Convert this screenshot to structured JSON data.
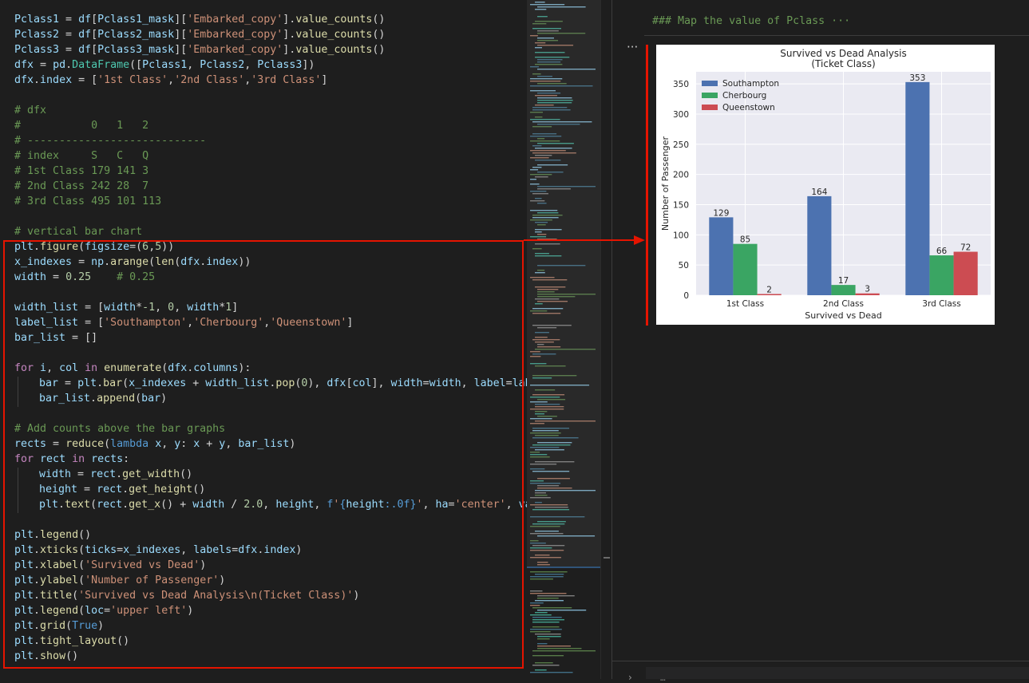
{
  "code_lines": [
    {
      "row": 0,
      "indent": 0,
      "tokens": [
        [
          "var",
          "Pclass1"
        ],
        [
          "p",
          " = "
        ],
        [
          "var",
          "df"
        ],
        [
          "p",
          "["
        ],
        [
          "var",
          "Pclass1_mask"
        ],
        [
          "p",
          "]["
        ],
        [
          "str",
          "'Embarked_copy'"
        ],
        [
          "p",
          "]."
        ],
        [
          "fn",
          "value_counts"
        ],
        [
          "p",
          "()"
        ]
      ]
    },
    {
      "row": 1,
      "indent": 0,
      "tokens": [
        [
          "var",
          "Pclass2"
        ],
        [
          "p",
          " = "
        ],
        [
          "var",
          "df"
        ],
        [
          "p",
          "["
        ],
        [
          "var",
          "Pclass2_mask"
        ],
        [
          "p",
          "]["
        ],
        [
          "str",
          "'Embarked_copy'"
        ],
        [
          "p",
          "]."
        ],
        [
          "fn",
          "value_counts"
        ],
        [
          "p",
          "()"
        ]
      ]
    },
    {
      "row": 2,
      "indent": 0,
      "tokens": [
        [
          "var",
          "Pclass3"
        ],
        [
          "p",
          " = "
        ],
        [
          "var",
          "df"
        ],
        [
          "p",
          "["
        ],
        [
          "var",
          "Pclass3_mask"
        ],
        [
          "p",
          "]["
        ],
        [
          "str",
          "'Embarked_copy'"
        ],
        [
          "p",
          "]."
        ],
        [
          "fn",
          "value_counts"
        ],
        [
          "p",
          "()"
        ]
      ]
    },
    {
      "row": 3,
      "indent": 0,
      "tokens": [
        [
          "var",
          "dfx"
        ],
        [
          "p",
          " = "
        ],
        [
          "var",
          "pd"
        ],
        [
          "p",
          "."
        ],
        [
          "cls",
          "DataFrame"
        ],
        [
          "p",
          "(["
        ],
        [
          "var",
          "Pclass1"
        ],
        [
          "p",
          ", "
        ],
        [
          "var",
          "Pclass2"
        ],
        [
          "p",
          ", "
        ],
        [
          "var",
          "Pclass3"
        ],
        [
          "p",
          "])"
        ]
      ]
    },
    {
      "row": 4,
      "indent": 0,
      "tokens": [
        [
          "var",
          "dfx"
        ],
        [
          "p",
          "."
        ],
        [
          "var",
          "index"
        ],
        [
          "p",
          " = ["
        ],
        [
          "str",
          "'1st Class'"
        ],
        [
          "p",
          ","
        ],
        [
          "str",
          "'2nd Class'"
        ],
        [
          "p",
          ","
        ],
        [
          "str",
          "'3rd Class'"
        ],
        [
          "p",
          "]"
        ]
      ]
    },
    {
      "row": 6,
      "indent": 0,
      "tokens": [
        [
          "cmt",
          "# dfx"
        ]
      ]
    },
    {
      "row": 7,
      "indent": 0,
      "tokens": [
        [
          "cmt",
          "#           0   1   2"
        ]
      ]
    },
    {
      "row": 8,
      "indent": 0,
      "tokens": [
        [
          "cmt",
          "# ----------------------------"
        ]
      ]
    },
    {
      "row": 9,
      "indent": 0,
      "tokens": [
        [
          "cmt",
          "# index     S   C   Q"
        ]
      ]
    },
    {
      "row": 10,
      "indent": 0,
      "tokens": [
        [
          "cmt",
          "# 1st Class 179 141 3"
        ]
      ]
    },
    {
      "row": 11,
      "indent": 0,
      "tokens": [
        [
          "cmt",
          "# 2nd Class 242 28  7"
        ]
      ]
    },
    {
      "row": 12,
      "indent": 0,
      "tokens": [
        [
          "cmt",
          "# 3rd Class 495 101 113"
        ]
      ]
    },
    {
      "row": 14,
      "indent": 0,
      "tokens": [
        [
          "cmt",
          "# vertical bar chart"
        ]
      ]
    },
    {
      "row": 15,
      "indent": 0,
      "tokens": [
        [
          "var",
          "plt"
        ],
        [
          "p",
          "."
        ],
        [
          "fn",
          "figure"
        ],
        [
          "p",
          "("
        ],
        [
          "var",
          "figsize"
        ],
        [
          "p",
          "=("
        ],
        [
          "num",
          "6"
        ],
        [
          "p",
          ","
        ],
        [
          "num",
          "5"
        ],
        [
          "p",
          "))"
        ]
      ]
    },
    {
      "row": 16,
      "indent": 0,
      "tokens": [
        [
          "var",
          "x_indexes"
        ],
        [
          "p",
          " = "
        ],
        [
          "var",
          "np"
        ],
        [
          "p",
          "."
        ],
        [
          "fn",
          "arange"
        ],
        [
          "p",
          "("
        ],
        [
          "fn",
          "len"
        ],
        [
          "p",
          "("
        ],
        [
          "var",
          "dfx"
        ],
        [
          "p",
          "."
        ],
        [
          "var",
          "index"
        ],
        [
          "p",
          "))"
        ]
      ]
    },
    {
      "row": 17,
      "indent": 0,
      "tokens": [
        [
          "var",
          "width"
        ],
        [
          "p",
          " = "
        ],
        [
          "num",
          "0.25"
        ],
        [
          "p",
          "    "
        ],
        [
          "cmt",
          "# 0.25"
        ]
      ]
    },
    {
      "row": 19,
      "indent": 0,
      "tokens": [
        [
          "var",
          "width_list"
        ],
        [
          "p",
          " = ["
        ],
        [
          "var",
          "width"
        ],
        [
          "p",
          "*"
        ],
        [
          "num",
          "-1"
        ],
        [
          "p",
          ", "
        ],
        [
          "num",
          "0"
        ],
        [
          "p",
          ", "
        ],
        [
          "var",
          "width"
        ],
        [
          "p",
          "*"
        ],
        [
          "num",
          "1"
        ],
        [
          "p",
          "]"
        ]
      ]
    },
    {
      "row": 20,
      "indent": 0,
      "tokens": [
        [
          "var",
          "label_list"
        ],
        [
          "p",
          " = ["
        ],
        [
          "str",
          "'Southampton'"
        ],
        [
          "p",
          ","
        ],
        [
          "str",
          "'Cherbourg'"
        ],
        [
          "p",
          ","
        ],
        [
          "str",
          "'Queenstown'"
        ],
        [
          "p",
          "]"
        ]
      ]
    },
    {
      "row": 21,
      "indent": 0,
      "tokens": [
        [
          "var",
          "bar_list"
        ],
        [
          "p",
          " = []"
        ]
      ]
    },
    {
      "row": 23,
      "indent": 0,
      "tokens": [
        [
          "kw",
          "for"
        ],
        [
          "p",
          " "
        ],
        [
          "var",
          "i"
        ],
        [
          "p",
          ", "
        ],
        [
          "var",
          "col"
        ],
        [
          "p",
          " "
        ],
        [
          "kw",
          "in"
        ],
        [
          "p",
          " "
        ],
        [
          "fn",
          "enumerate"
        ],
        [
          "p",
          "("
        ],
        [
          "var",
          "dfx"
        ],
        [
          "p",
          "."
        ],
        [
          "var",
          "columns"
        ],
        [
          "p",
          "):"
        ]
      ]
    },
    {
      "row": 24,
      "indent": 1,
      "tokens": [
        [
          "var",
          "bar"
        ],
        [
          "p",
          " = "
        ],
        [
          "var",
          "plt"
        ],
        [
          "p",
          "."
        ],
        [
          "fn",
          "bar"
        ],
        [
          "p",
          "("
        ],
        [
          "var",
          "x_indexes"
        ],
        [
          "p",
          " + "
        ],
        [
          "var",
          "width_list"
        ],
        [
          "p",
          "."
        ],
        [
          "fn",
          "pop"
        ],
        [
          "p",
          "("
        ],
        [
          "num",
          "0"
        ],
        [
          "p",
          "), "
        ],
        [
          "var",
          "dfx"
        ],
        [
          "p",
          "["
        ],
        [
          "var",
          "col"
        ],
        [
          "p",
          "], "
        ],
        [
          "var",
          "width"
        ],
        [
          "p",
          "="
        ],
        [
          "var",
          "width"
        ],
        [
          "p",
          ", "
        ],
        [
          "var",
          "label"
        ],
        [
          "p",
          "="
        ],
        [
          "var",
          "label"
        ]
      ]
    },
    {
      "row": 25,
      "indent": 1,
      "tokens": [
        [
          "var",
          "bar_list"
        ],
        [
          "p",
          "."
        ],
        [
          "fn",
          "append"
        ],
        [
          "p",
          "("
        ],
        [
          "var",
          "bar"
        ],
        [
          "p",
          ")"
        ]
      ]
    },
    {
      "row": 27,
      "indent": 0,
      "tokens": [
        [
          "cmt",
          "# Add counts above the bar graphs"
        ]
      ]
    },
    {
      "row": 28,
      "indent": 0,
      "tokens": [
        [
          "var",
          "rects"
        ],
        [
          "p",
          " = "
        ],
        [
          "fn",
          "reduce"
        ],
        [
          "p",
          "("
        ],
        [
          "const",
          "lambda"
        ],
        [
          "p",
          " "
        ],
        [
          "var",
          "x"
        ],
        [
          "p",
          ", "
        ],
        [
          "var",
          "y"
        ],
        [
          "p",
          ": "
        ],
        [
          "var",
          "x"
        ],
        [
          "p",
          " + "
        ],
        [
          "var",
          "y"
        ],
        [
          "p",
          ", "
        ],
        [
          "var",
          "bar_list"
        ],
        [
          "p",
          ")"
        ]
      ]
    },
    {
      "row": 29,
      "indent": 0,
      "tokens": [
        [
          "kw",
          "for"
        ],
        [
          "p",
          " "
        ],
        [
          "var",
          "rect"
        ],
        [
          "p",
          " "
        ],
        [
          "kw",
          "in"
        ],
        [
          "p",
          " "
        ],
        [
          "var",
          "rects"
        ],
        [
          "p",
          ":"
        ]
      ]
    },
    {
      "row": 30,
      "indent": 1,
      "tokens": [
        [
          "var",
          "width"
        ],
        [
          "p",
          " = "
        ],
        [
          "var",
          "rect"
        ],
        [
          "p",
          "."
        ],
        [
          "fn",
          "get_width"
        ],
        [
          "p",
          "()"
        ]
      ]
    },
    {
      "row": 31,
      "indent": 1,
      "tokens": [
        [
          "var",
          "height"
        ],
        [
          "p",
          " = "
        ],
        [
          "var",
          "rect"
        ],
        [
          "p",
          "."
        ],
        [
          "fn",
          "get_height"
        ],
        [
          "p",
          "()"
        ]
      ]
    },
    {
      "row": 32,
      "indent": 1,
      "tokens": [
        [
          "var",
          "plt"
        ],
        [
          "p",
          "."
        ],
        [
          "fn",
          "text"
        ],
        [
          "p",
          "("
        ],
        [
          "var",
          "rect"
        ],
        [
          "p",
          "."
        ],
        [
          "fn",
          "get_x"
        ],
        [
          "p",
          "() + "
        ],
        [
          "var",
          "width"
        ],
        [
          "p",
          " / "
        ],
        [
          "num",
          "2.0"
        ],
        [
          "p",
          ", "
        ],
        [
          "var",
          "height"
        ],
        [
          "p",
          ", "
        ],
        [
          "const",
          "f"
        ],
        [
          "str",
          "'"
        ],
        [
          "const",
          "{"
        ],
        [
          "var",
          "height"
        ],
        [
          "const",
          ":.0f}"
        ],
        [
          "str",
          "'"
        ],
        [
          "p",
          ", "
        ],
        [
          "var",
          "ha"
        ],
        [
          "p",
          "="
        ],
        [
          "str",
          "'center'"
        ],
        [
          "p",
          ", "
        ],
        [
          "var",
          "va"
        ],
        [
          "p",
          "="
        ],
        [
          "str",
          "'"
        ]
      ]
    },
    {
      "row": 34,
      "indent": 0,
      "tokens": [
        [
          "var",
          "plt"
        ],
        [
          "p",
          "."
        ],
        [
          "fn",
          "legend"
        ],
        [
          "p",
          "()"
        ]
      ]
    },
    {
      "row": 35,
      "indent": 0,
      "tokens": [
        [
          "var",
          "plt"
        ],
        [
          "p",
          "."
        ],
        [
          "fn",
          "xticks"
        ],
        [
          "p",
          "("
        ],
        [
          "var",
          "ticks"
        ],
        [
          "p",
          "="
        ],
        [
          "var",
          "x_indexes"
        ],
        [
          "p",
          ", "
        ],
        [
          "var",
          "labels"
        ],
        [
          "p",
          "="
        ],
        [
          "var",
          "dfx"
        ],
        [
          "p",
          "."
        ],
        [
          "var",
          "index"
        ],
        [
          "p",
          ")"
        ]
      ]
    },
    {
      "row": 36,
      "indent": 0,
      "tokens": [
        [
          "var",
          "plt"
        ],
        [
          "p",
          "."
        ],
        [
          "fn",
          "xlabel"
        ],
        [
          "p",
          "("
        ],
        [
          "str",
          "'Survived vs Dead'"
        ],
        [
          "p",
          ")"
        ]
      ]
    },
    {
      "row": 37,
      "indent": 0,
      "tokens": [
        [
          "var",
          "plt"
        ],
        [
          "p",
          "."
        ],
        [
          "fn",
          "ylabel"
        ],
        [
          "p",
          "("
        ],
        [
          "str",
          "'Number of Passenger'"
        ],
        [
          "p",
          ")"
        ]
      ]
    },
    {
      "row": 38,
      "indent": 0,
      "tokens": [
        [
          "var",
          "plt"
        ],
        [
          "p",
          "."
        ],
        [
          "fn",
          "title"
        ],
        [
          "p",
          "("
        ],
        [
          "str",
          "'Survived vs Dead Analysis\\n(Ticket Class)'"
        ],
        [
          "p",
          ")"
        ]
      ]
    },
    {
      "row": 39,
      "indent": 0,
      "tokens": [
        [
          "var",
          "plt"
        ],
        [
          "p",
          "."
        ],
        [
          "fn",
          "legend"
        ],
        [
          "p",
          "("
        ],
        [
          "var",
          "loc"
        ],
        [
          "p",
          "="
        ],
        [
          "str",
          "'upper left'"
        ],
        [
          "p",
          ")"
        ]
      ]
    },
    {
      "row": 40,
      "indent": 0,
      "tokens": [
        [
          "var",
          "plt"
        ],
        [
          "p",
          "."
        ],
        [
          "fn",
          "grid"
        ],
        [
          "p",
          "("
        ],
        [
          "const",
          "True"
        ],
        [
          "p",
          ")"
        ]
      ]
    },
    {
      "row": 41,
      "indent": 0,
      "tokens": [
        [
          "var",
          "plt"
        ],
        [
          "p",
          "."
        ],
        [
          "fn",
          "tight_layout"
        ],
        [
          "p",
          "()"
        ]
      ]
    },
    {
      "row": 42,
      "indent": 0,
      "tokens": [
        [
          "var",
          "plt"
        ],
        [
          "p",
          "."
        ],
        [
          "fn",
          "show"
        ],
        [
          "p",
          "()"
        ]
      ]
    }
  ],
  "output": {
    "markdown_heading": "### Map the value of Pclass ···",
    "more_actions": "···",
    "next_cell_text": "…"
  },
  "chart_data": {
    "type": "bar",
    "title": "Survived vs Dead Analysis\n(Ticket Class)",
    "xlabel": "Survived vs Dead",
    "ylabel": "Number of Passenger",
    "categories": [
      "1st Class",
      "2nd Class",
      "3rd Class"
    ],
    "series": [
      {
        "name": "Southampton",
        "values": [
          129,
          164,
          353
        ],
        "color": "#4c72b0"
      },
      {
        "name": "Cherbourg",
        "values": [
          85,
          17,
          66
        ],
        "color": "#3aa563"
      },
      {
        "name": "Queenstown",
        "values": [
          2,
          3,
          72
        ],
        "color": "#cc4c52"
      }
    ],
    "ylim": [
      0,
      370
    ],
    "yticks": [
      0,
      50,
      100,
      150,
      200,
      250,
      300,
      350
    ],
    "grid": true,
    "legend_loc": "upper-left",
    "background": "#eaeaf2"
  },
  "colors": {
    "annotation_red": "#e51400",
    "editor_bg": "#1e1e1e"
  }
}
